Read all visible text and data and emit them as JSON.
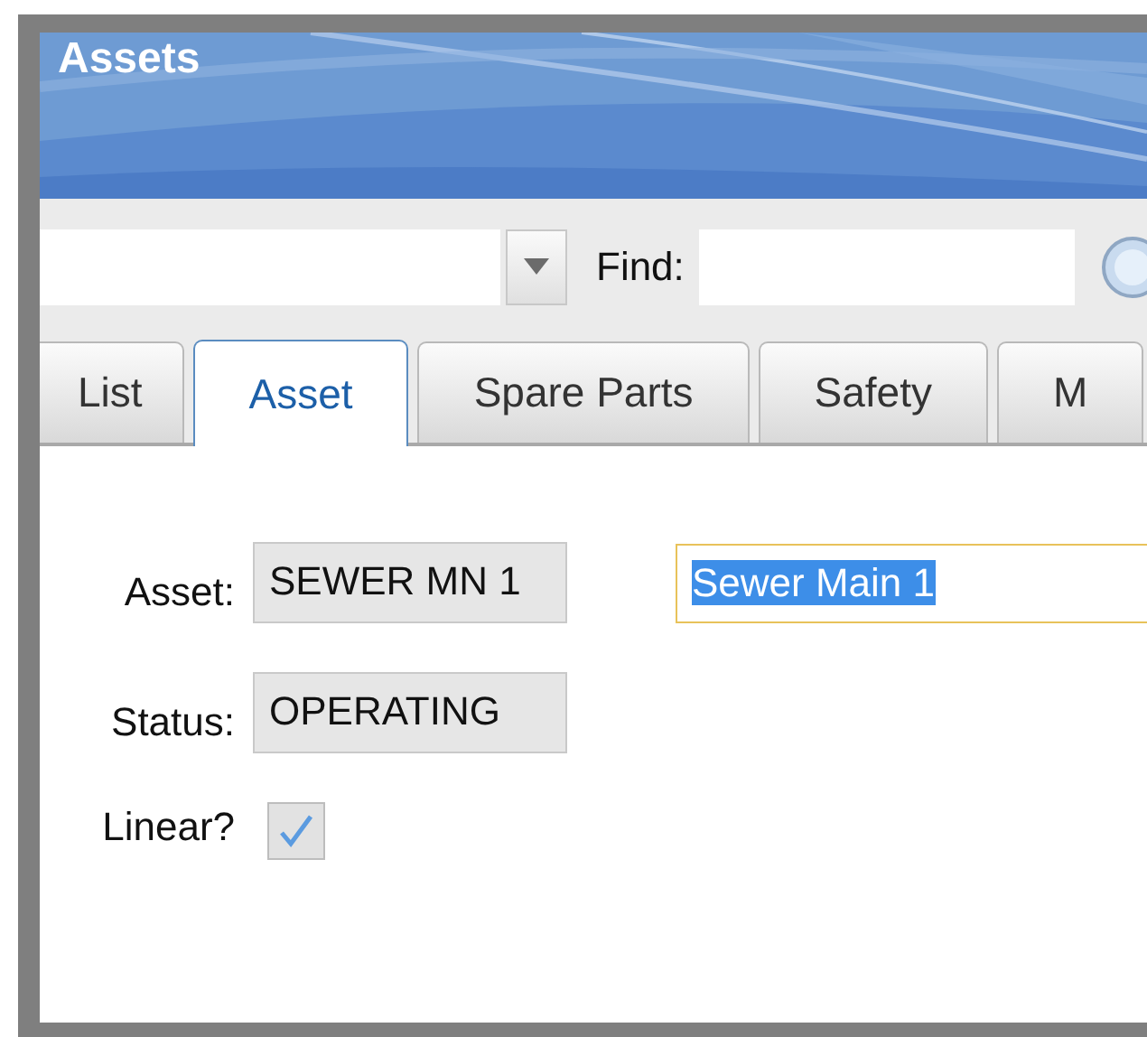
{
  "header": {
    "title": "Assets"
  },
  "toolbar": {
    "find_label": "Find:"
  },
  "tabs": [
    {
      "label": "List",
      "selected": false
    },
    {
      "label": "Asset",
      "selected": true
    },
    {
      "label": "Spare Parts",
      "selected": false
    },
    {
      "label": "Safety",
      "selected": false
    },
    {
      "label": "M",
      "selected": false
    }
  ],
  "fields": [
    {
      "label": "Asset:",
      "value": "SEWER MN 1",
      "read_only": true
    },
    {
      "label": "Status:",
      "value": "OPERATING",
      "read_only": true
    }
  ],
  "description": {
    "value": "Sewer Main 1",
    "text_selected": true,
    "focused": true
  },
  "linear": {
    "label": "Linear?",
    "checked": true,
    "read_only": true
  }
}
